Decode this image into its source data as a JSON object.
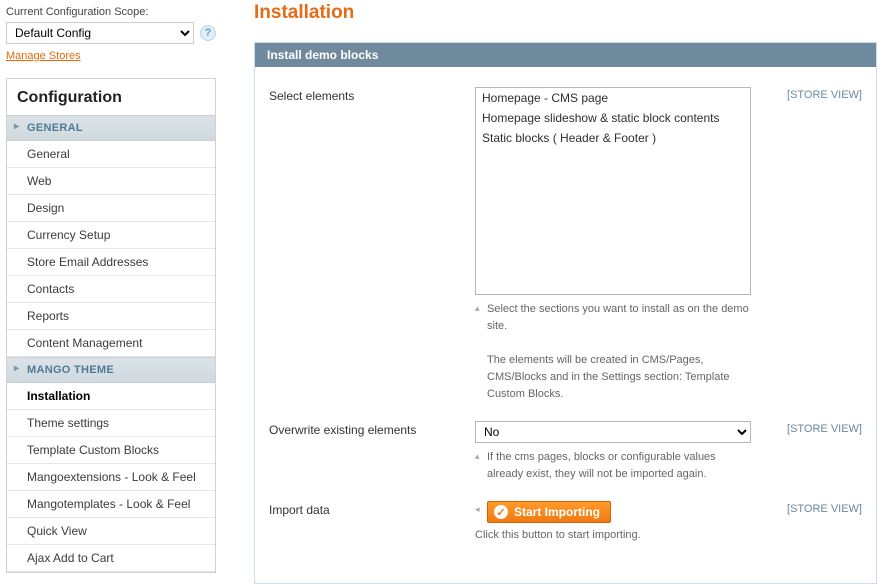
{
  "sidebar": {
    "scope_label": "Current Configuration Scope:",
    "scope_value": "Default Config",
    "manage_stores": "Manage Stores",
    "config_title": "Configuration",
    "groups": [
      {
        "label": "GENERAL",
        "items": [
          {
            "label": "General"
          },
          {
            "label": "Web"
          },
          {
            "label": "Design"
          },
          {
            "label": "Currency Setup"
          },
          {
            "label": "Store Email Addresses"
          },
          {
            "label": "Contacts"
          },
          {
            "label": "Reports"
          },
          {
            "label": "Content Management"
          }
        ]
      },
      {
        "label": "MANGO THEME",
        "items": [
          {
            "label": "Installation",
            "active": true
          },
          {
            "label": "Theme settings"
          },
          {
            "label": "Template Custom Blocks"
          },
          {
            "label": "Mangoextensions - Look & Feel"
          },
          {
            "label": "Mangotemplates - Look & Feel"
          },
          {
            "label": "Quick View"
          },
          {
            "label": "Ajax Add to Cart"
          }
        ]
      }
    ]
  },
  "main": {
    "title": "Installation",
    "panel_title": "Install demo blocks",
    "scope_text": "[STORE VIEW]",
    "rows": {
      "select_elements": {
        "label": "Select elements",
        "options": [
          "Homepage - CMS page",
          "Homepage slideshow & static block contents",
          "Static blocks ( Header & Footer )"
        ],
        "hint": "Select the sections you want to install as on the demo site.",
        "hint2": "The elements will be created in CMS/Pages, CMS/Blocks and in the Settings section: Template Custom Blocks."
      },
      "overwrite": {
        "label": "Overwrite existing elements",
        "value": "No",
        "hint": "If the cms pages, blocks or configurable values already exist, they will not be imported again."
      },
      "import": {
        "label": "Import data",
        "button": "Start Importing",
        "hint": "Click this button to start importing."
      }
    }
  }
}
